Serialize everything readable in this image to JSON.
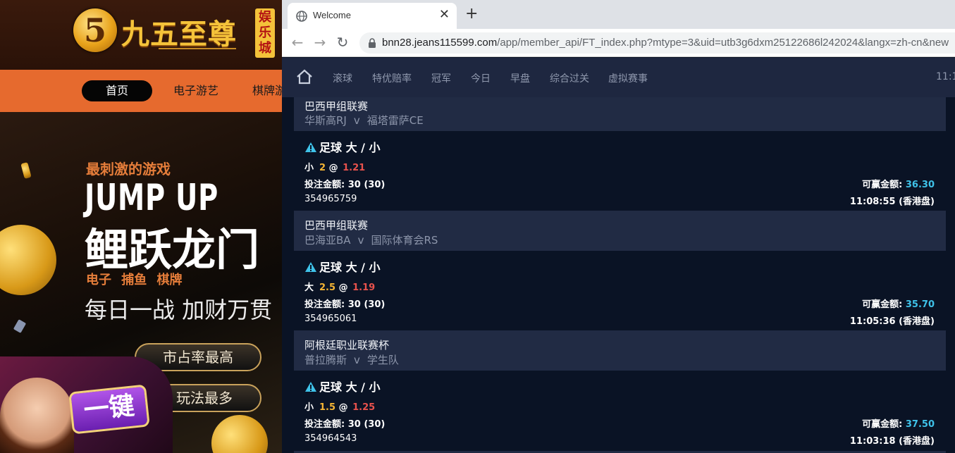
{
  "casino": {
    "logo_digit": "5",
    "logo_text": "九五至尊",
    "logo_seal": "娱乐城",
    "nav": [
      "首页",
      "电子游艺",
      "棋牌游戏"
    ],
    "slogan_small": "最刺激的游戏",
    "slogan_jump": "JUMP UP",
    "slogan_big": "鲤跃龙门",
    "slogan_cats": "电子 捕鱼 棋牌",
    "slogan_daily": "每日一战 加财万贯",
    "pill_1": "市占率最高",
    "pill_2": "玩法最多",
    "promo_label": "一键"
  },
  "browser": {
    "tab_title": "Welcome",
    "url_host": "bnn28.jeans115599.com",
    "url_path": "/app/member_api/FT_index.php?mtype=3&uid=utb3g6dxm25122686l242024&langx=zh-cn&new"
  },
  "app_nav": {
    "items": [
      "滚球",
      "特优赔率",
      "冠军",
      "今日",
      "早盘",
      "综合过关",
      "虚拟赛事"
    ],
    "clock": "11:1"
  },
  "bets": [
    {
      "league": "巴西甲组联赛",
      "home": "华斯高RJ",
      "away": "福塔雷萨CE",
      "vs": "v",
      "bet_type": "足球 大 / 小",
      "selection": "小",
      "line": "2",
      "odds": "1.21",
      "stake_label": "投注金额:",
      "stake": "30 (30)",
      "win_label": "可赢金额:",
      "win": "36.30",
      "ticket": "354965759",
      "time": "11:08:55 (香港盘)"
    },
    {
      "league": "巴西甲组联赛",
      "home": "巴海亚BA",
      "away": "国际体育会RS",
      "vs": "v",
      "bet_type": "足球 大 / 小",
      "selection": "大",
      "line": "2.5",
      "odds": "1.19",
      "stake_label": "投注金额:",
      "stake": "30 (30)",
      "win_label": "可赢金额:",
      "win": "35.70",
      "ticket": "354965061",
      "time": "11:05:36 (香港盘)"
    },
    {
      "league": "阿根廷职业联赛杯",
      "home": "普拉腾斯",
      "away": "学生队",
      "vs": "v",
      "bet_type": "足球 大 / 小",
      "selection": "小",
      "line": "1.5",
      "odds": "1.25",
      "stake_label": "投注金额:",
      "stake": "30 (30)",
      "win_label": "可赢金额:",
      "win": "37.50",
      "ticket": "354964543",
      "time": "11:03:18 (香港盘)"
    }
  ],
  "colors": {
    "app_bg": "#0a1325",
    "match_header_bg": "#212b44",
    "line_color": "#f5b534",
    "odds_color": "#e9524d",
    "win_color": "#3fc3ea",
    "casino_nav_bg": "#e66a2e"
  }
}
